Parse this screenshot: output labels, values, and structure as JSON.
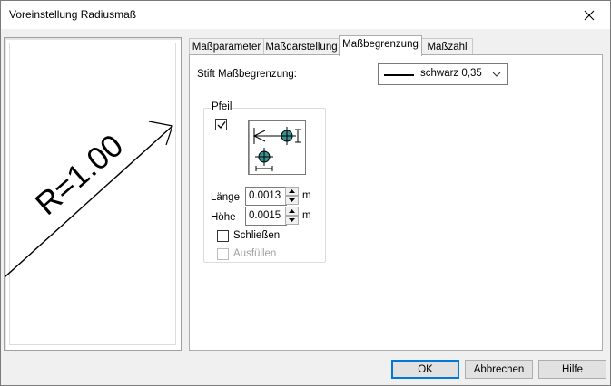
{
  "window": {
    "title": "Voreinstellung Radiusmaß"
  },
  "preview": {
    "text": "R=1.00"
  },
  "tabs": [
    {
      "label": "Maßparameter",
      "active": false
    },
    {
      "label": "Maßdarstellung",
      "active": false
    },
    {
      "label": "Maßbegrenzung",
      "active": true
    },
    {
      "label": "Maßzahl",
      "active": false
    }
  ],
  "panel": {
    "pen_label": "Stift Maßbegrenzung:",
    "pen_value": "schwarz 0,35",
    "arrow_group": {
      "legend": "Pfeil",
      "checked": true,
      "length_label": "Länge",
      "length_value": "0.0013",
      "length_unit": "m",
      "height_label": "Höhe",
      "height_value": "0.0015",
      "height_unit": "m",
      "close_label": "Schließen",
      "close_checked": false,
      "fill_label": "Ausfüllen",
      "fill_checked": false,
      "fill_disabled": true
    }
  },
  "buttons": {
    "ok": "OK",
    "cancel": "Abbrechen",
    "help": "Hilfe"
  },
  "colors": {
    "accent": "#0078d7",
    "symbol_fill": "#3a8f8f"
  }
}
